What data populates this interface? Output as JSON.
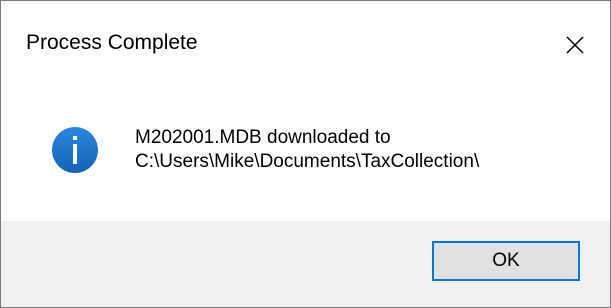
{
  "dialog": {
    "title": "Process Complete",
    "close_icon": "close-icon",
    "info_icon": "info-icon",
    "info_icon_color": "#1a6fc7",
    "message_lines": [
      "M202001.MDB downloaded to",
      "C:\\Users\\Mike\\Documents\\TaxCollection\\"
    ],
    "ok_label": "OK",
    "accent": "#0078d7"
  }
}
